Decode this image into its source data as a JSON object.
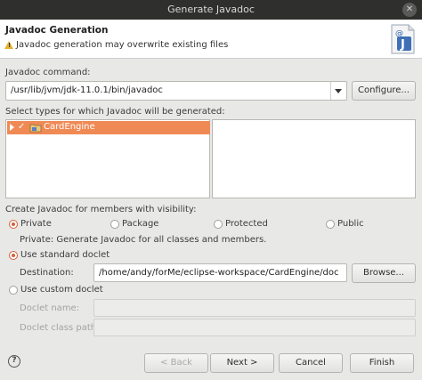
{
  "window": {
    "title": "Generate Javadoc",
    "close_glyph": "✕"
  },
  "header": {
    "title": "Javadoc Generation",
    "message": "Javadoc generation may overwrite existing files",
    "warning_glyph": "!",
    "wizard_icon_letter": "J",
    "wizard_icon_at": "@"
  },
  "command": {
    "label": "Javadoc command:",
    "value": "/usr/lib/jvm/jdk-11.0.1/bin/javadoc",
    "configure_label": "Configure..."
  },
  "types": {
    "label": "Select types for which Javadoc will be generated:",
    "tree": [
      {
        "name": "CardEngine",
        "checked": true,
        "selected": true
      }
    ],
    "check_glyph": "✓"
  },
  "visibility": {
    "label": "Create Javadoc for members with visibility:",
    "options": [
      {
        "label": "Private",
        "selected": true
      },
      {
        "label": "Package",
        "selected": false
      },
      {
        "label": "Protected",
        "selected": false
      },
      {
        "label": "Public",
        "selected": false
      }
    ],
    "description": "Private: Generate Javadoc for all classes and members."
  },
  "doclet": {
    "standard_label": "Use standard doclet",
    "destination_label": "Destination:",
    "destination_value": "/home/andy/forMe/eclipse-workspace/CardEngine/doc",
    "browse_label": "Browse...",
    "custom_label": "Use custom doclet",
    "doclet_name_label": "Doclet name:",
    "doclet_class_path_label": "Doclet class path:"
  },
  "footer": {
    "help_glyph": "?",
    "back_label": "< Back",
    "next_label": "Next >",
    "cancel_label": "Cancel",
    "finish_label": "Finish"
  },
  "colors": {
    "selection": "#f08a55",
    "accent": "#d4623a",
    "titlebar": "#2f2f2d",
    "warning": "#e6b22d"
  }
}
